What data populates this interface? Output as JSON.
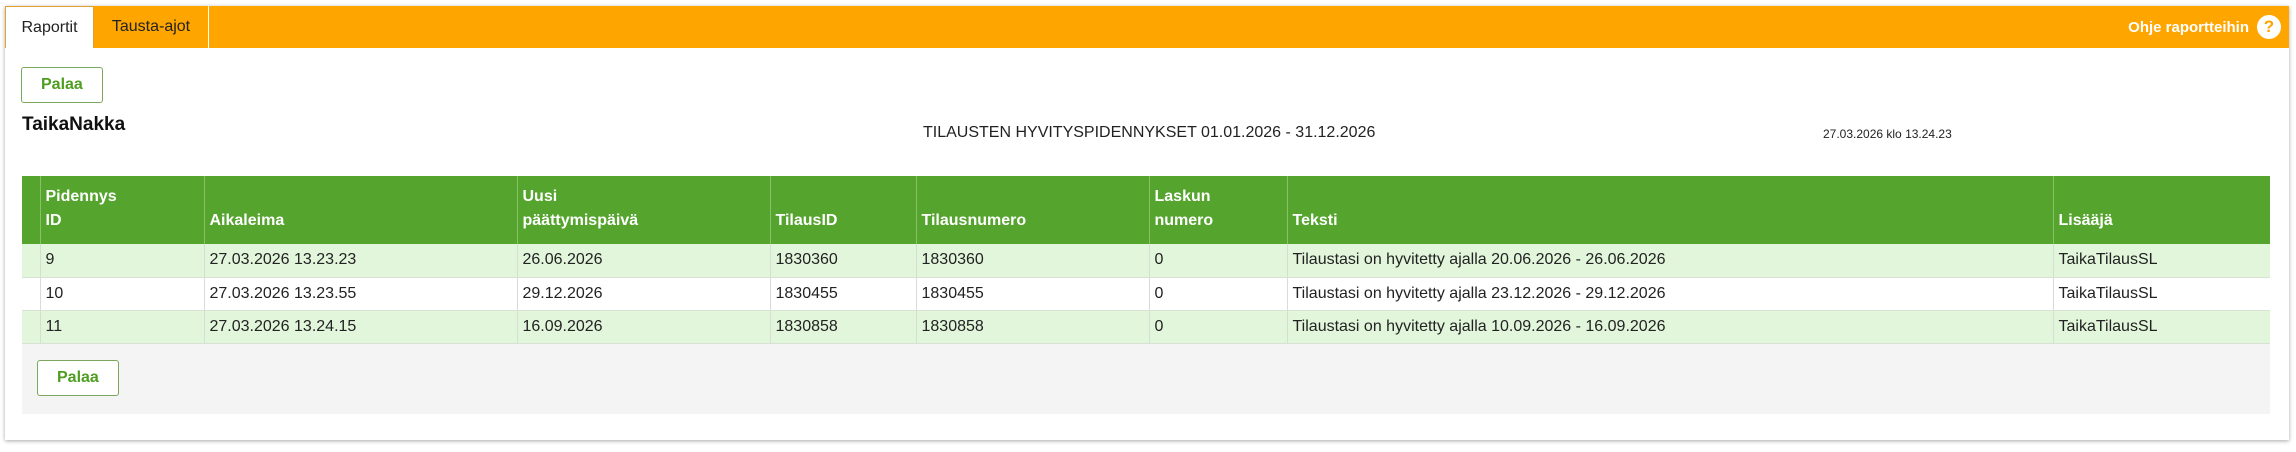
{
  "tabs": [
    {
      "label": "Raportit",
      "active": true
    },
    {
      "label": "Tausta-ajot",
      "active": false
    }
  ],
  "help": {
    "label": "Ohje raportteihin",
    "icon": "help-icon"
  },
  "back_button_label": "Palaa",
  "company_name": "TaikaNakka",
  "report_title": "TILAUSTEN HYVITYSPIDENNYKSET 01.01.2026 - 31.12.2026",
  "generated_at": "27.03.2026 klo 13.24.23",
  "table": {
    "headers": [
      {
        "line1": "Pidennys",
        "line2": "ID"
      },
      {
        "line1": "",
        "line2": "Aikaleima"
      },
      {
        "line1": "Uusi",
        "line2": "päättymispäivä"
      },
      {
        "line1": "",
        "line2": "TilausID"
      },
      {
        "line1": "",
        "line2": "Tilausnumero"
      },
      {
        "line1": "Laskun",
        "line2": "numero"
      },
      {
        "line1": "",
        "line2": "Teksti"
      },
      {
        "line1": "",
        "line2": "Lisääjä"
      }
    ],
    "rows": [
      [
        "9",
        "27.03.2026 13.23.23",
        "26.06.2026",
        "1830360",
        "1830360",
        "0",
        "Tilaustasi on hyvitetty ajalla 20.06.2026 - 26.06.2026",
        "TaikaTilausSL"
      ],
      [
        "10",
        "27.03.2026 13.23.55",
        "29.12.2026",
        "1830455",
        "1830455",
        "0",
        "Tilaustasi on hyvitetty ajalla 23.12.2026 - 29.12.2026",
        "TaikaTilausSL"
      ],
      [
        "11",
        "27.03.2026 13.24.15",
        "16.09.2026",
        "1830858",
        "1830858",
        "0",
        "Tilaustasi on hyvitetty ajalla 10.09.2026 - 16.09.2026",
        "TaikaTilausSL"
      ]
    ]
  },
  "colors": {
    "accent": "#ffa500",
    "table_header": "#55a42d",
    "row_alt": "#e2f6dc",
    "button_text": "#4f9e22"
  }
}
